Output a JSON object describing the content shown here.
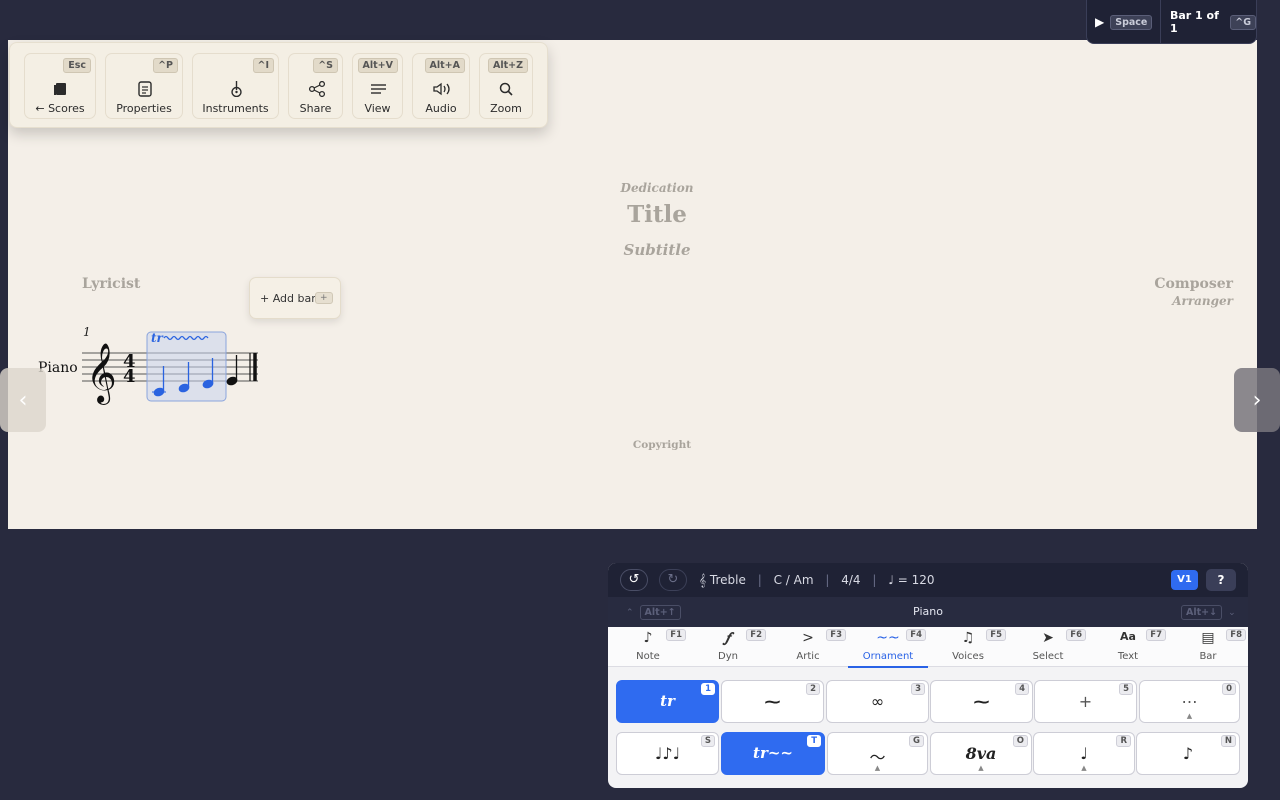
{
  "toolbar": {
    "buttons": [
      {
        "label": "← Scores",
        "key": "Esc",
        "icon": "book-icon"
      },
      {
        "label": "Properties",
        "key": "^P",
        "icon": "document-icon"
      },
      {
        "label": "Instruments",
        "key": "^I",
        "icon": "guitar-icon"
      },
      {
        "label": "Share",
        "key": "^S",
        "icon": "share-icon"
      },
      {
        "label": "View",
        "key": "Alt+V",
        "icon": "lines-icon"
      },
      {
        "label": "Audio",
        "key": "Alt+A",
        "icon": "speaker-icon"
      },
      {
        "label": "Zoom",
        "key": "Alt+Z",
        "icon": "magnifier-icon"
      }
    ]
  },
  "playback": {
    "play_key": "Space",
    "bar_label": "Bar 1 of 1",
    "goto_key": "^G"
  },
  "score": {
    "dedication": "Dedication",
    "title": "Title",
    "subtitle": "Subtitle",
    "lyricist": "Lyricist",
    "composer": "Composer",
    "arranger": "Arranger",
    "copyright": "Copyright",
    "instrument": "Piano",
    "bar_number": "1",
    "time_signature_top": "4",
    "time_signature_bottom": "4"
  },
  "add_bar": {
    "label": "+ Add bar",
    "key": "+"
  },
  "panel": {
    "clef": "𝄞 Treble",
    "key": "C / Am",
    "time": "4/4",
    "tempo": "♩ = 120",
    "voice_badge": "V1",
    "help": "?",
    "instrument": "Piano",
    "prev_inst_key": "Alt+↑",
    "next_inst_key": "Alt+↓",
    "tabs": [
      {
        "label": "Note",
        "key": "F1",
        "glyph": "♪"
      },
      {
        "label": "Dyn",
        "key": "F2",
        "glyph": "𝆑"
      },
      {
        "label": "Artic",
        "key": "F3",
        "glyph": ">"
      },
      {
        "label": "Ornament",
        "key": "F4",
        "glyph": "~~"
      },
      {
        "label": "Voices",
        "key": "F5",
        "glyph": "♫"
      },
      {
        "label": "Select",
        "key": "F6",
        "glyph": "➤"
      },
      {
        "label": "Text",
        "key": "F7",
        "glyph": "Aa"
      },
      {
        "label": "Bar",
        "key": "F8",
        "glyph": "▤"
      }
    ],
    "ornaments_row1": [
      {
        "key": "1",
        "glyph": "tr",
        "selected": true
      },
      {
        "key": "2",
        "glyph": "⁓",
        "selected": false
      },
      {
        "key": "3",
        "glyph": "∞",
        "selected": false
      },
      {
        "key": "4",
        "glyph": "⁓",
        "selected": false
      },
      {
        "key": "5",
        "glyph": "+",
        "selected": false
      },
      {
        "key": "0",
        "glyph": "…",
        "selected": false
      }
    ],
    "ornaments_row2": [
      {
        "key": "S",
        "glyph": "♩♪♩",
        "selected": false
      },
      {
        "key": "T",
        "glyph": "tr~~",
        "selected": true
      },
      {
        "key": "G",
        "glyph": "〜",
        "selected": false
      },
      {
        "key": "O",
        "glyph": "8va",
        "selected": false
      },
      {
        "key": "R",
        "glyph": "♩",
        "selected": false
      },
      {
        "key": "N",
        "glyph": "♪",
        "selected": false
      }
    ]
  },
  "colors": {
    "accent": "#2f6bf0",
    "canvas": "#f4efe8",
    "dark": "#1f2235",
    "selection": "#2a63e0"
  }
}
